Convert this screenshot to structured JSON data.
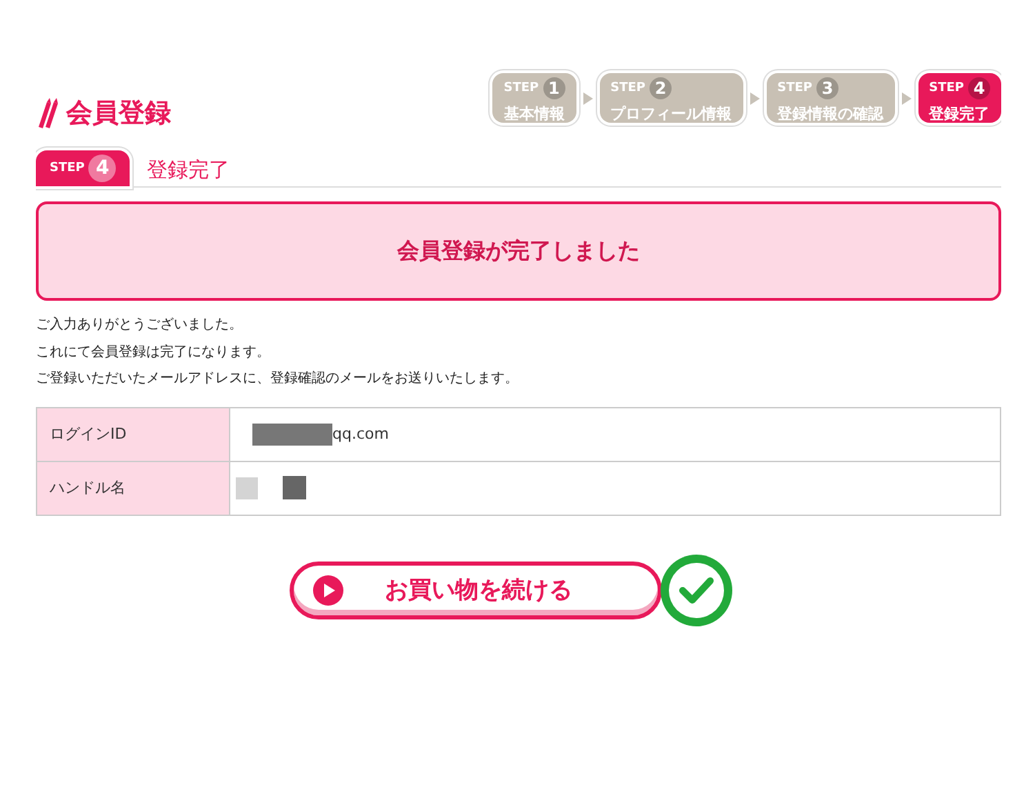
{
  "page_title": "会員登録",
  "steps": [
    {
      "label": "STEP",
      "number": "1",
      "name": "基本情報",
      "selected": false
    },
    {
      "label": "STEP",
      "number": "2",
      "name": "プロフィール情報",
      "selected": false
    },
    {
      "label": "STEP",
      "number": "3",
      "name": "登録情報の確認",
      "selected": false
    },
    {
      "label": "STEP",
      "number": "4",
      "name": "登録完了",
      "selected": true
    }
  ],
  "section_tab": {
    "label": "STEP",
    "number": "4",
    "title": "登録完了"
  },
  "banner": "会員登録が完了しました",
  "messages": [
    "ご入力ありがとうございました。",
    "これにて会員登録は完了になります。",
    "ご登録いただいたメールアドレスに、登録確認のメールをお送りいたします。"
  ],
  "table": {
    "rows": [
      {
        "label": "ログインID",
        "value": "qq.com"
      },
      {
        "label": "ハンドル名",
        "value": ""
      }
    ]
  },
  "continue_button": "お買い物を続ける"
}
